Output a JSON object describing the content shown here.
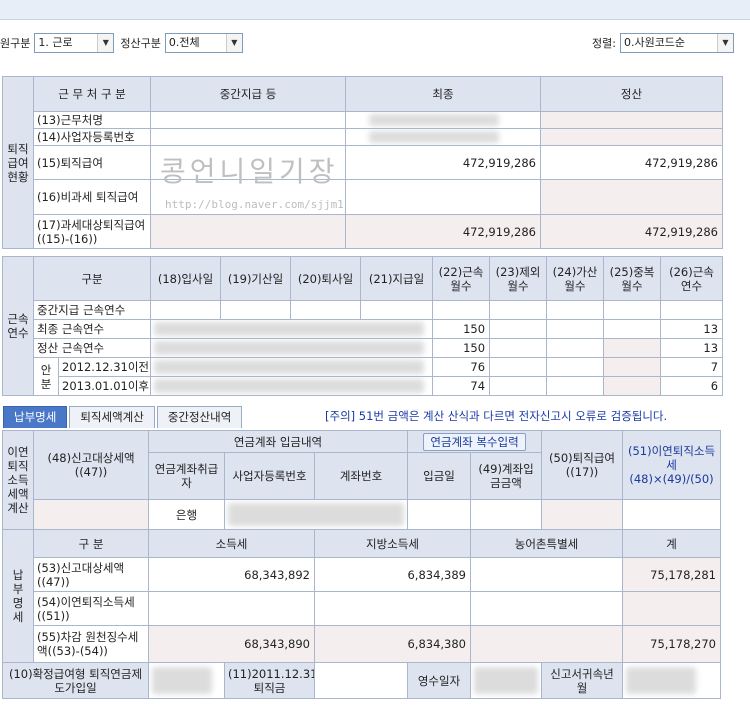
{
  "filters": {
    "gubun_label": "원구분",
    "gubun_value": "1. 근로",
    "settle_label": "정산구분",
    "settle_value": "0.전체",
    "sort_label": "정렬:",
    "sort_value": "0.사원코드순"
  },
  "section1": {
    "side_label": "퇴직급여현황",
    "headers": [
      "근 무 처 구 분",
      "중간지급 등",
      "최종",
      "정산"
    ],
    "rows": [
      {
        "label": "(13)근무처명",
        "mid": "",
        "final": "",
        "settle": ""
      },
      {
        "label": "(14)사업자등록번호",
        "mid": "",
        "final": "",
        "settle": ""
      },
      {
        "label": "(15)퇴직급여",
        "mid": "",
        "final": "472,919,286",
        "settle": "472,919,286"
      },
      {
        "label": "(16)비과세 퇴직급여",
        "mid": "",
        "final": "",
        "settle": ""
      },
      {
        "label": "(17)과세대상퇴직급여((15)-(16))",
        "mid": "",
        "final": "472,919,286",
        "settle": "472,919,286"
      }
    ]
  },
  "watermark": {
    "text": "콩언니일기장",
    "url": "http://blog.naver.com/sjjm1"
  },
  "section2": {
    "side_label": "근속연수",
    "headers": [
      "구분",
      "(18)입사일",
      "(19)기산일",
      "(20)퇴사일",
      "(21)지급일",
      "(22)근속월수",
      "(23)제외월수",
      "(24)가산월수",
      "(25)중복월수",
      "(26)근속연수"
    ],
    "rows": [
      {
        "label": "중간지급 근속연수",
        "months": "",
        "years": ""
      },
      {
        "label": "최종 근속연수",
        "months": "150",
        "years": "13"
      },
      {
        "label": "정산 근속연수",
        "months": "150",
        "years": "13"
      }
    ],
    "split_label": "안분",
    "split_rows": [
      {
        "label": "2012.12.31이전",
        "months": "76",
        "years": "7"
      },
      {
        "label": "2013.01.01이후",
        "months": "74",
        "years": "6"
      }
    ]
  },
  "tabs": [
    {
      "label": "납부명세",
      "active": true
    },
    {
      "label": "퇴직세액계산",
      "active": false
    },
    {
      "label": "중간정산내역",
      "active": false
    }
  ],
  "notice": "[주의] 51번 금액은 계산 산식과 다르면 전자신고시 오류로 검증됩니다.",
  "section3": {
    "side_label": "이연퇴직소득세액계산",
    "col48": "(48)신고대상세액((47))",
    "group_header": "연금계좌 입금내역",
    "multi_button": "연금계좌 복수입력",
    "col_handler": "연금계좌취급자",
    "col_bizno": "사업자등록번호",
    "col_account": "계좌번호",
    "col_date": "입금일",
    "col49": "(49)계좌입금금액",
    "col50": "(50)퇴직급여((17))",
    "col51": "(51)이연퇴직소득세(48)×(49)/(50)",
    "row_handler": "은행"
  },
  "section4": {
    "side_label": "납부명세",
    "headers": [
      "구 분",
      "소득세",
      "지방소득세",
      "농어촌특별세",
      "계"
    ],
    "rows": [
      {
        "label": "(53)신고대상세액((47))",
        "income": "68,343,892",
        "local": "6,834,389",
        "rural": "",
        "total": "75,178,281"
      },
      {
        "label": "(54)이연퇴직소득세((51))",
        "income": "",
        "local": "",
        "rural": "",
        "total": ""
      },
      {
        "label": "(55)차감 원천징수세액((53)-(54))",
        "income": "68,343,890",
        "local": "6,834,380",
        "rural": "",
        "total": "75,178,270"
      }
    ]
  },
  "footer": {
    "dc_label": "(10)확정급여형 퇴직연금제도가입일",
    "y2011_label": "(11)2011.12.31퇴직금",
    "receipt_label": "영수일자",
    "report_label": "신고서귀속년월"
  }
}
